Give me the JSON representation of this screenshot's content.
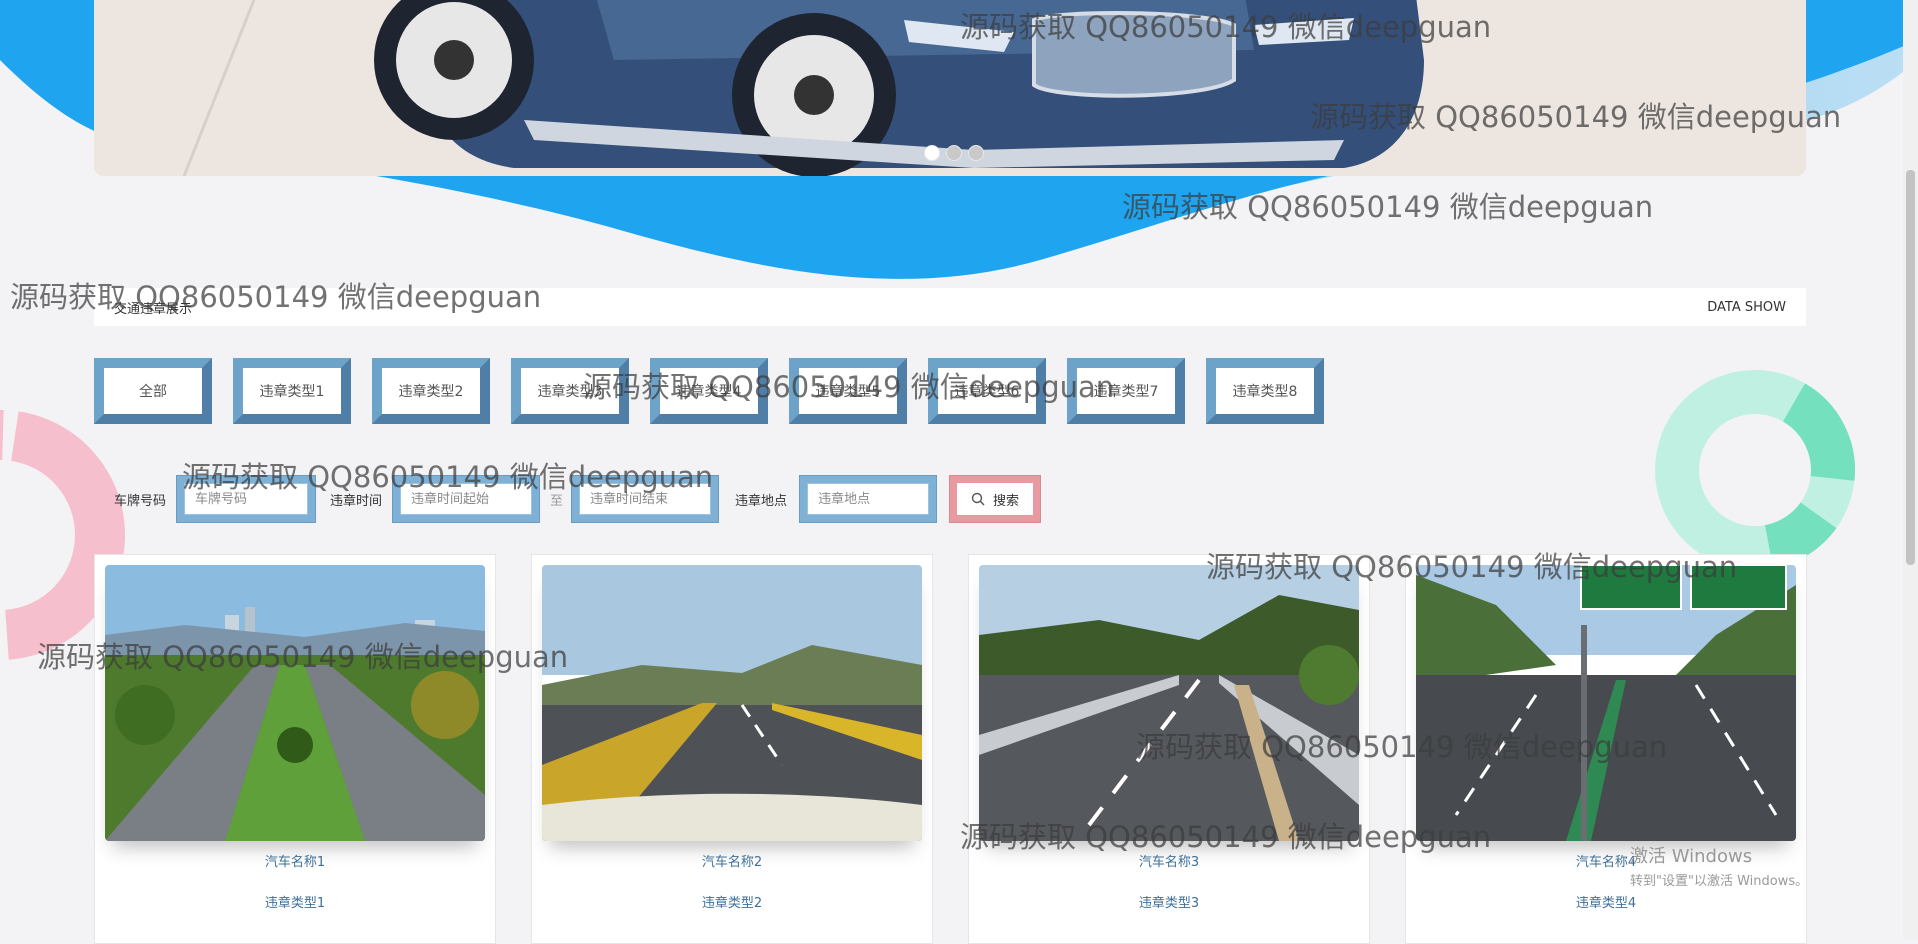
{
  "banner": {
    "slides": 3,
    "active_slide": 1
  },
  "section": {
    "title": "交通违章展示",
    "subtitle": "DATA SHOW"
  },
  "filters": [
    "全部",
    "违章类型1",
    "违章类型2",
    "违章类型3",
    "违章类型4",
    "违章类型5",
    "违章类型6",
    "违章类型7",
    "违章类型8"
  ],
  "search": {
    "plate_label": "车牌号码",
    "plate_placeholder": "车牌号码",
    "time_label": "违章时间",
    "time_start_placeholder": "违章时间起始",
    "time_sep": "至",
    "time_end_placeholder": "违章时间结束",
    "place_label": "违章地点",
    "place_placeholder": "违章地点",
    "button_label": "搜索"
  },
  "cards": [
    {
      "name": "汽车名称1",
      "type": "违章类型1"
    },
    {
      "name": "汽车名称2",
      "type": "违章类型2"
    },
    {
      "name": "汽车名称3",
      "type": "违章类型3"
    },
    {
      "name": "汽车名称4",
      "type": "违章类型4"
    }
  ],
  "watermark_text": "源码获取 QQ86050149 微信deepguan",
  "os_notice": {
    "line1": "激活 Windows",
    "line2": "转到\"设置\"以激活 Windows。"
  },
  "colors": {
    "accent_blue": "#3c6a90",
    "wave_blue": "#1fa5f0",
    "search_pink": "#e99aa1",
    "link_blue": "#3f6f98"
  }
}
